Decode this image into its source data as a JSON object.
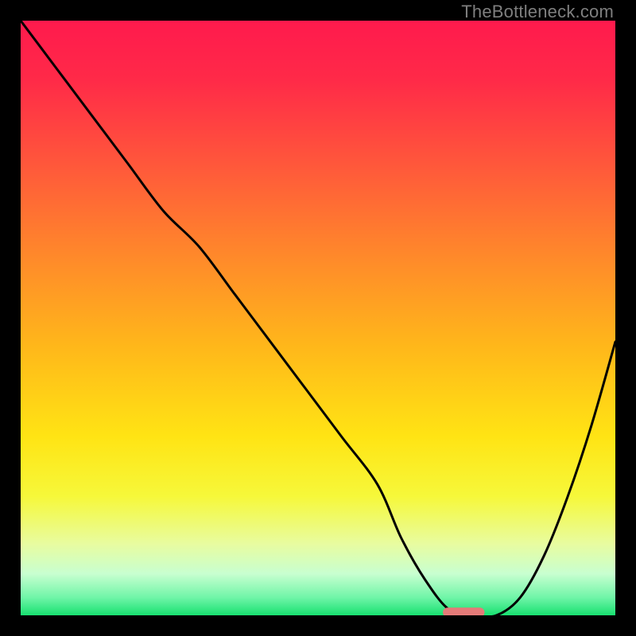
{
  "watermark": "TheBottleneck.com",
  "chart_data": {
    "type": "line",
    "title": "",
    "xlabel": "",
    "ylabel": "",
    "xlim": [
      0,
      100
    ],
    "ylim": [
      0,
      100
    ],
    "x": [
      0,
      6,
      12,
      18,
      24,
      30,
      36,
      42,
      48,
      54,
      60,
      64,
      68,
      72,
      76,
      80,
      84,
      88,
      92,
      96,
      100
    ],
    "values": [
      100,
      92,
      84,
      76,
      68,
      62,
      54,
      46,
      38,
      30,
      22,
      13,
      6,
      1,
      0,
      0,
      3,
      10,
      20,
      32,
      46
    ],
    "marker": {
      "x_start": 71,
      "x_end": 78,
      "y": 0.5
    },
    "gradient_stops": [
      {
        "offset": 0.0,
        "color": "#ff1a4d"
      },
      {
        "offset": 0.1,
        "color": "#ff2a48"
      },
      {
        "offset": 0.25,
        "color": "#ff5a3a"
      },
      {
        "offset": 0.4,
        "color": "#ff8a2a"
      },
      {
        "offset": 0.55,
        "color": "#ffb81a"
      },
      {
        "offset": 0.7,
        "color": "#ffe414"
      },
      {
        "offset": 0.8,
        "color": "#f6f83a"
      },
      {
        "offset": 0.88,
        "color": "#e8fca0"
      },
      {
        "offset": 0.93,
        "color": "#c8ffd0"
      },
      {
        "offset": 0.97,
        "color": "#70f5a8"
      },
      {
        "offset": 1.0,
        "color": "#18e070"
      }
    ]
  }
}
